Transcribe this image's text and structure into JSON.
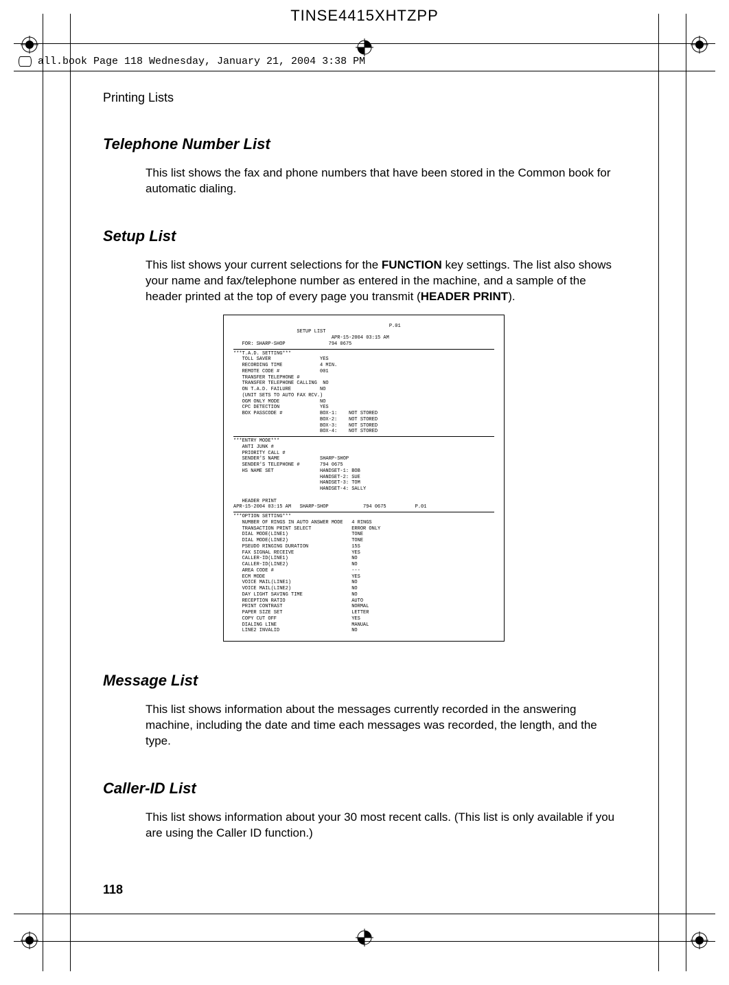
{
  "header_code": "TINSE4415XHTZPP",
  "book_line": "all.book  Page 118  Wednesday, January 21, 2004  3:38 PM",
  "running_head": "Printing Lists",
  "page_number": "118",
  "sections": {
    "tel": {
      "title": "Telephone Number List",
      "para": "This list shows the fax and phone numbers that have been stored in the Common book for automatic dialing."
    },
    "setup": {
      "title": "Setup List",
      "para_pre": "This list shows your current selections for the ",
      "para_b1": "FUNCTION",
      "para_mid": " key settings. The list also shows your name and fax/telephone number as entered in the machine, and a sample of the header printed at the top of every page you transmit (",
      "para_b2": "HEADER PRINT",
      "para_post": ")."
    },
    "msg": {
      "title": "Message List",
      "para": "This list shows information about the messages currently recorded in the answering machine, including the date and time each messages was recorded, the length, and the type."
    },
    "cid": {
      "title": "Caller-ID List",
      "para": "This list shows information about your 30 most recent calls. (This list is only available if you are using the Caller ID function.)"
    }
  },
  "setup_list_image": {
    "page_label_top": "P.01",
    "title": "SETUP LIST",
    "datetime": "APR-15-2004 03:15 AM",
    "for_line": "FOR: SHARP-SHOP               794 0675",
    "tad_header": "***T.A.D. SETTING***",
    "tad_rows": [
      "TOLL SAVER                 YES",
      "RECORDING TIME             4 MIN.",
      "REMOTE CODE #              001",
      "TRANSFER TELEPHONE #",
      "TRANSFER TELEPHONE CALLING  NO",
      "ON T.A.D. FAILURE          NO",
      "(UNIT SETS TO AUTO FAX RCV.)",
      "OGM ONLY MODE              NO",
      "CPC DETECTION              YES",
      "BOX PASSCODE #             BOX-1:    NOT STORED",
      "                           BOX-2:    NOT STORED",
      "                           BOX-3:    NOT STORED",
      "                           BOX-4:    NOT STORED"
    ],
    "entry_header": "***ENTRY MODE***",
    "entry_rows": [
      "ANTI JUNK #",
      "PRIORITY CALL #",
      "SENDER'S NAME              SHARP-SHOP",
      "SENDER'S TELEPHONE #       794 0675",
      "HS NAME SET                HANDSET-1: BOB",
      "                           HANDSET-2: SUE",
      "                           HANDSET-3: TOM",
      "                           HANDSET-4: SALLY"
    ],
    "header_print": "HEADER PRINT",
    "header_line": "APR-15-2004 03:15 AM   SHARP-SHOP            794 0675          P.01",
    "option_header": "***OPTION SETTING***",
    "option_rows": [
      "NUMBER OF RINGS IN AUTO ANSWER MODE   4 RINGS",
      "TRANSACTION PRINT SELECT              ERROR ONLY",
      "DIAL MODE(LINE1)                      TONE",
      "DIAL MODE(LINE2)                      TONE",
      "PSEUDO RINGING DURATION               15S",
      "FAX SIGNAL RECEIVE                    YES",
      "CALLER-ID(LINE1)                      NO",
      "CALLER-ID(LINE2)                      NO",
      "AREA CODE #                           ---",
      "ECM MODE                              YES",
      "VOICE MAIL(LINE1)                     NO",
      "VOICE MAIL(LINE2)                     NO",
      "DAY LIGHT SAVING TIME                 NO",
      "RECEPTION RATIO                       AUTO",
      "PRINT CONTRAST                        NORMAL",
      "PAPER SIZE SET                        LETTER",
      "COPY CUT OFF                          YES",
      "DIALING LINE                          MANUAL",
      "LINE2 INVALID                         NO"
    ]
  }
}
